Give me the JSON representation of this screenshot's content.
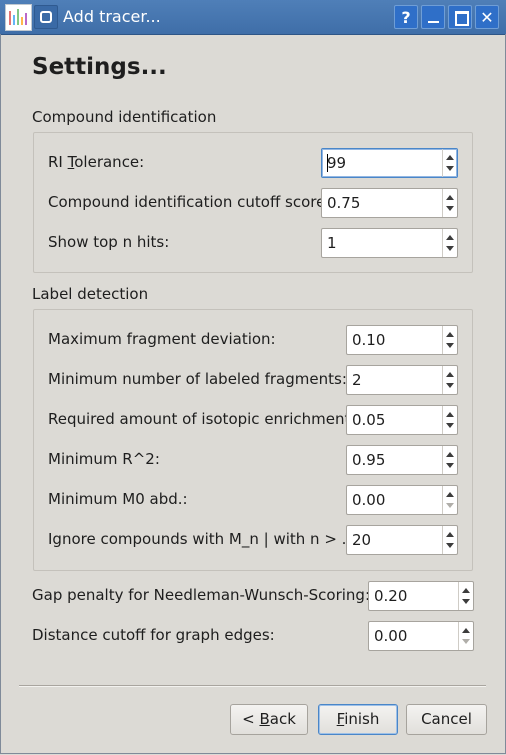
{
  "window": {
    "title": "Add tracer...",
    "help_label": "?",
    "close_label": "✕"
  },
  "heading": "Settings...",
  "compound_group": {
    "title": "Compound identification",
    "fields": [
      {
        "label_pre": "RI ",
        "label_mnemonic": "T",
        "label_post": "olerance:",
        "value": "99"
      },
      {
        "label": "Compound identification cutoff score:",
        "value": "0.75"
      },
      {
        "label": "Show top n hits:",
        "value": "1"
      }
    ]
  },
  "label_group": {
    "title": "Label detection",
    "fields": [
      {
        "label": "Maximum fragment deviation:",
        "value": "0.10"
      },
      {
        "label": "Minimum number of labeled fragments:",
        "value": "2"
      },
      {
        "label": "Required amount of isotopic enrichment:",
        "value": "0.05"
      },
      {
        "label": "Minimum R^2:",
        "value": "0.95"
      },
      {
        "label": "Minimum M0 abd.:",
        "value": "0.00"
      },
      {
        "label": "Ignore compounds with M_n | with n > ...:",
        "value": "20"
      }
    ]
  },
  "extra": [
    {
      "label": "Gap penalty for Needleman-Wunsch-Scoring:",
      "value": "0.20"
    },
    {
      "label": "Distance cutoff for graph edges:",
      "value": "0.00"
    }
  ],
  "buttons": {
    "back_pre": "< ",
    "back_mnemonic": "B",
    "back_post": "ack",
    "finish_mnemonic": "F",
    "finish_post": "inish",
    "cancel": "Cancel"
  }
}
